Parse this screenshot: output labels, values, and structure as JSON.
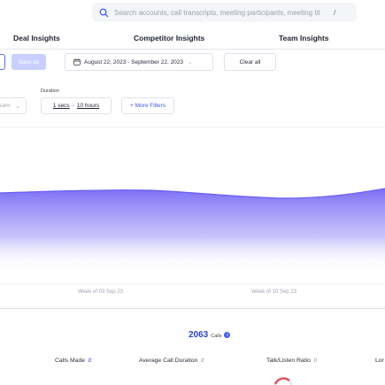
{
  "search": {
    "placeholder": "Search accounts, call transcripts, meeting participants, meeting tit",
    "shortcut": "/"
  },
  "tabs": [
    "Deal Insights",
    "Competitor Insights",
    "Team Insights"
  ],
  "filters": {
    "save_as_label": "Save as",
    "date_range": "August 22, 2023 - September 22, 2023",
    "clear_all_label": "Clear all",
    "team_stub_label": "eam",
    "duration_label": "Duration",
    "duration_min": "1 secs",
    "duration_sep": "-",
    "duration_max": "10 hours",
    "more_filters_label": "+ More Filters"
  },
  "chart": {
    "x_ticks": [
      "Week of 03 Sep 23",
      "Week of 10 Sep 23"
    ],
    "area_color": "#7b6ef6"
  },
  "summary": {
    "calls_total": "2063",
    "calls_label": "Calls",
    "info_glyph": "i"
  },
  "table": {
    "columns": [
      {
        "label": "Calls Made",
        "sort": "active"
      },
      {
        "label": "Average Call Duration",
        "sort": "none"
      },
      {
        "label": "Talk/Listen Ratio",
        "sort": "none"
      },
      {
        "label": "Lor",
        "sort": "none"
      }
    ]
  },
  "icons": {
    "search": "search-icon",
    "calendar": "calendar-icon",
    "chevron": "chevron-down-icon",
    "info": "info-icon",
    "sort": "sort-icon"
  }
}
